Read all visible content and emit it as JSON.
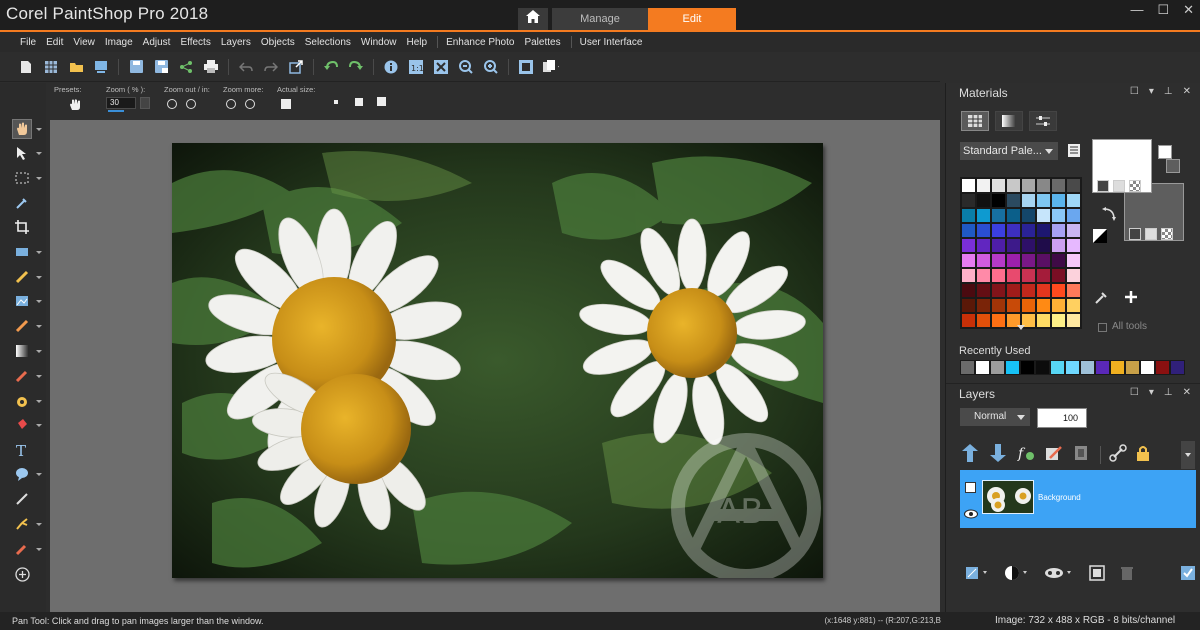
{
  "app": {
    "title": "Corel PaintShop Pro 2018",
    "tabs": [
      {
        "label": "Manage"
      },
      {
        "label": "Edit"
      }
    ],
    "window_controls": [
      "—",
      "☐",
      "✕"
    ]
  },
  "menu": [
    "File",
    "Edit",
    "View",
    "Image",
    "Adjust",
    "Effects",
    "Layers",
    "Objects",
    "Selections",
    "Window",
    "Help",
    "Enhance Photo",
    "Palettes",
    "User Interface"
  ],
  "tool_options": {
    "presets_label": "Presets:",
    "zoom_label": "Zoom ( % ):",
    "zoom_value": "30",
    "zoom_out_in_label": "Zoom out / in:",
    "zoom_more_label": "Zoom more:",
    "actual_size_label": "Actual size:"
  },
  "status": {
    "tool_hint": "Pan Tool: Click and drag to pan images larger than the window.",
    "coords": "(x:1648 y:881) -- (R:207,G:213,B",
    "image_info": "Image:  732 x 488 x RGB - 8 bits/channel"
  },
  "materials": {
    "title": "Materials",
    "palette_name": "Standard Pale...",
    "all_tools_label": "All tools",
    "recently_used_label": "Recently Used",
    "swatches": [
      "#ffffff",
      "#f2f2f2",
      "#e0e0e0",
      "#c8c8c8",
      "#a8a8a8",
      "#888888",
      "#6a6a6a",
      "#4a4a4a",
      "#2a2a2a",
      "#111111",
      "#000000",
      "#2b4a60",
      "#a7d4f0",
      "#7ec6f0",
      "#5ab4ec",
      "#9fd7f7",
      "#0a7ea8",
      "#0e9ad0",
      "#176fa0",
      "#0b5f8a",
      "#14466a",
      "#c6e5fb",
      "#8bc7f6",
      "#6aa7ef",
      "#1f59c4",
      "#2a4ed2",
      "#3b3fe0",
      "#3d2fc0",
      "#2a2296",
      "#1d1770",
      "#a7a2f2",
      "#c9b6f2",
      "#7a2fd8",
      "#6126c0",
      "#4e1ea8",
      "#3d1a8a",
      "#2e1068",
      "#1f0c4a",
      "#cda0f0",
      "#e6b8ff",
      "#e57cf0",
      "#d05ce0",
      "#b63ac8",
      "#9c20ac",
      "#7a1888",
      "#5a0f64",
      "#3f0a46",
      "#f7c8fa",
      "#ffb0c8",
      "#ff8aa8",
      "#ff6e8e",
      "#e84a6e",
      "#c83252",
      "#a41c3a",
      "#7a0e24",
      "#fcd2dc",
      "#4a0a10",
      "#640e14",
      "#82141a",
      "#a01c1a",
      "#c2281c",
      "#e2361e",
      "#ff4a1e",
      "#ff7a5a",
      "#5a1808",
      "#7a2408",
      "#a03408",
      "#c84a08",
      "#e86408",
      "#ff8a14",
      "#ffb036",
      "#ffd060",
      "#c83008",
      "#e2500a",
      "#ff7014",
      "#ff9a2a",
      "#ffbe46",
      "#ffdc64",
      "#fff088",
      "#ffe8a0"
    ],
    "recent": [
      "#6b6b6b",
      "#ffffff",
      "#9c9c9c",
      "#17c2f6",
      "#000000",
      "#0c0c0c",
      "#57d6f4",
      "#6fd8ff",
      "#9ec0d8",
      "#5a28b8",
      "#f0b020",
      "#c8a048",
      "#ffffff",
      "#8a1010",
      "#30207a"
    ]
  },
  "layers": {
    "title": "Layers",
    "blend_mode": "Normal",
    "opacity": "100",
    "layer_name": "Background"
  },
  "canvas": {
    "watermark_text": "AB"
  }
}
